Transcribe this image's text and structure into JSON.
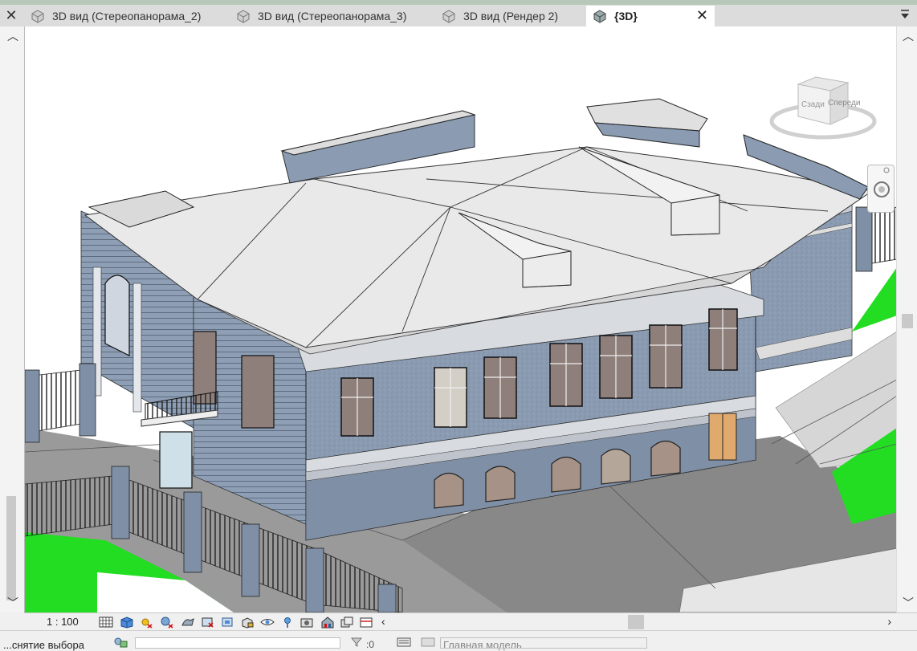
{
  "tabs": [
    {
      "label": "3D вид (Стереопанорама_2)",
      "active": false
    },
    {
      "label": "3D вид (Стереопанорама_3)",
      "active": false
    },
    {
      "label": "3D вид (Рендер 2)",
      "active": false
    },
    {
      "label": "{3D}",
      "active": true
    }
  ],
  "viewcube": {
    "left_face": "Сзади",
    "front_face": "Спереди"
  },
  "viewbar": {
    "scale": "1 : 100"
  },
  "statusbar": {
    "selection_hint": "...снятие выбора",
    "model": "Главная модель",
    "selection_count": ":0"
  },
  "colors": {
    "wall": "#8a9bb2",
    "roof": "#e9e9e9",
    "ground": "#999999",
    "grass": "#22dd22",
    "window_glass": "#8e7f7a"
  }
}
